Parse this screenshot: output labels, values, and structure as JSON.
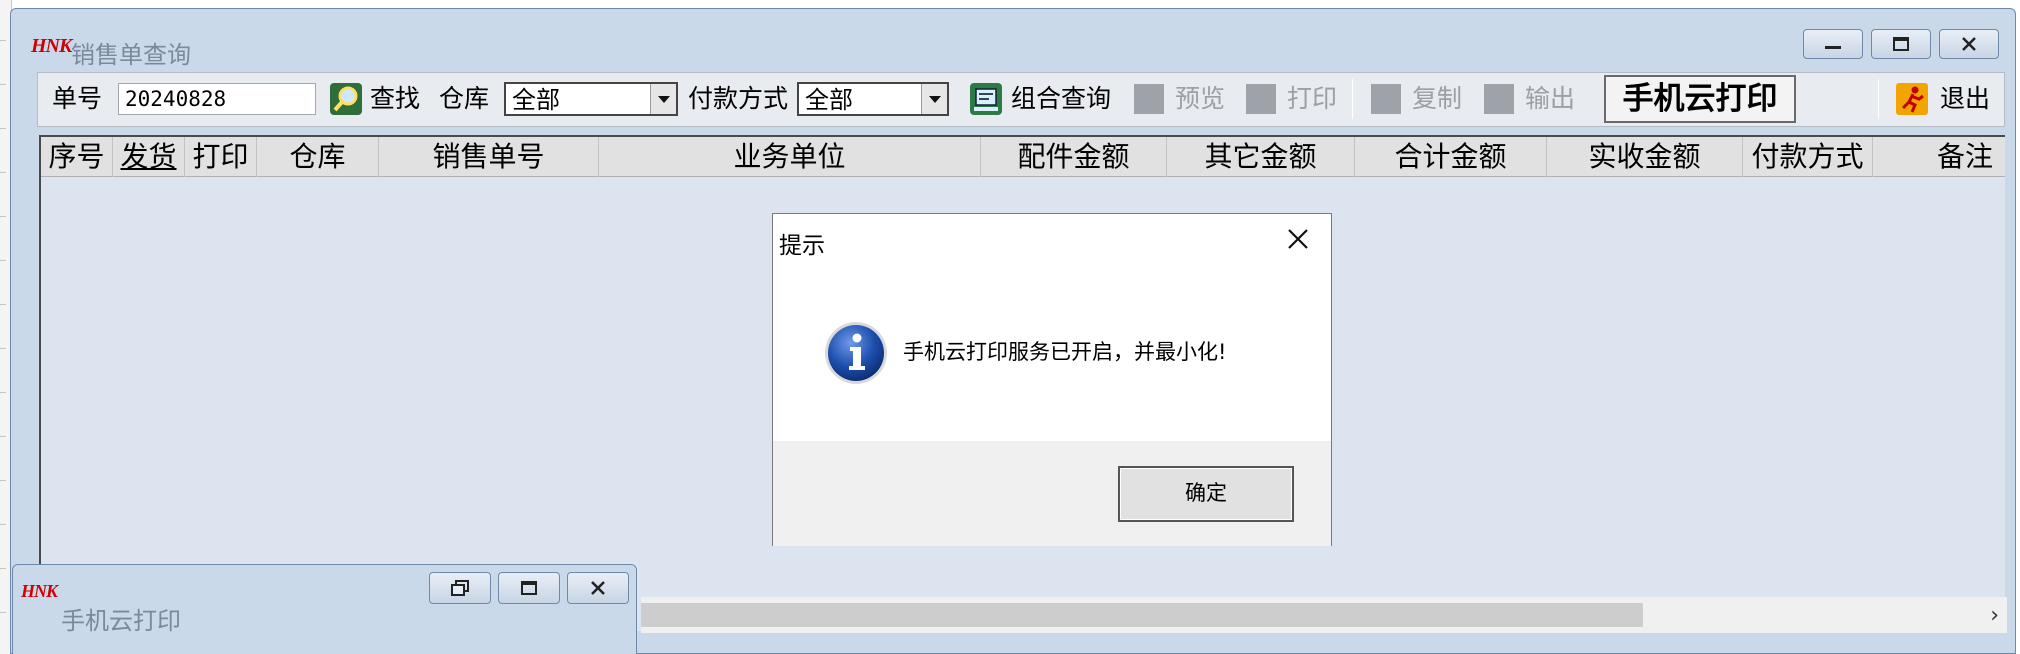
{
  "main_window": {
    "title": "销售单查询",
    "logo_text": "HNK",
    "controls": {
      "minimize": "minimize-icon",
      "maximize": "maximize-icon",
      "close": "close-icon"
    }
  },
  "toolbar": {
    "order_no_label": "单号",
    "order_no_value": "20240828",
    "find_label": "查找",
    "warehouse_label": "仓库",
    "warehouse_value": "全部",
    "payment_label": "付款方式",
    "payment_value": "全部",
    "combo_query_label": "组合查询",
    "preview_label": "预览",
    "print_label": "打印",
    "copy_label": "复制",
    "export_label": "输出",
    "cloud_print_label": "手机云打印",
    "exit_label": "退出"
  },
  "grid": {
    "columns": [
      "序号",
      "发货",
      "打印",
      "仓库",
      "销售单号",
      "业务单位",
      "配件金额",
      "其它金额",
      "合计金额",
      "实收金额",
      "付款方式",
      "备注"
    ],
    "rows": []
  },
  "dialog": {
    "title": "提示",
    "message": "手机云打印服务已开启，并最小化!",
    "ok_label": "确定",
    "icon": "info-icon"
  },
  "mini_window": {
    "title": "手机云打印",
    "logo_text": "HNK"
  },
  "colors": {
    "window_frame": "#c9d9ea",
    "grid_background": "#dce5ef",
    "info_icon_blue": "#1d4fae",
    "logo_red": "#d00000"
  }
}
